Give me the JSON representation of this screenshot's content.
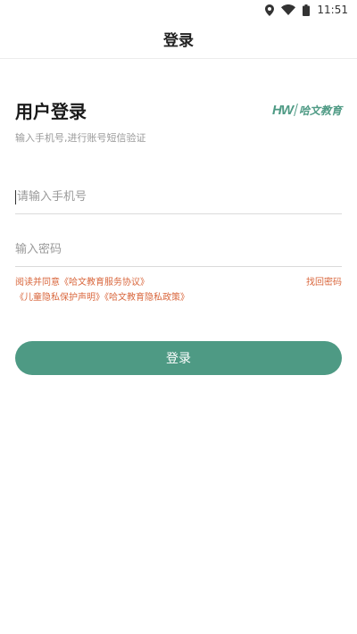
{
  "status_bar": {
    "time": "11:51",
    "icons": [
      "location-icon",
      "wifi-icon",
      "battery-icon"
    ]
  },
  "header": {
    "title": "登录"
  },
  "login": {
    "heading": "用户登录",
    "brand": {
      "mark": "HW",
      "name": "哈文教育",
      "color": "#4e9a84"
    },
    "subtitle": "输入手机号,进行账号短信验证",
    "phone_placeholder": "请输入手机号",
    "phone_value": "",
    "password_placeholder": "输入密码",
    "password_value": "",
    "agreement": {
      "prefix": "阅读并同意",
      "service_agreement": "《哈文教育服务协议》",
      "child_privacy": "《儿童隐私保护声明》",
      "privacy_policy": "《哈文教育隐私政策》",
      "forgot_password": "找回密码",
      "color": "#d9673d"
    },
    "submit_label": "登录",
    "accent": "#4e9a84"
  }
}
